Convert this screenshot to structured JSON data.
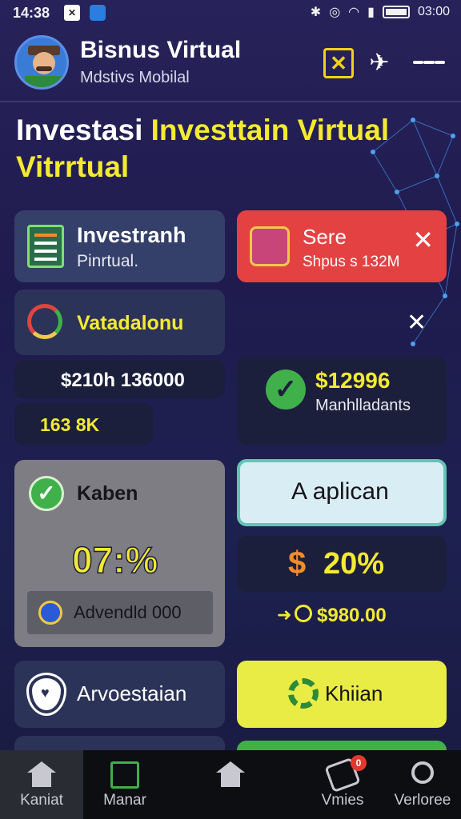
{
  "status_bar": {
    "time": "14:38",
    "clock_right": "03:00"
  },
  "header": {
    "title": "Bisnus Virtual",
    "subtitle": "Mdstivs Mobilal"
  },
  "headline": {
    "part1": "Investasi ",
    "part2": "Investtain Virtual",
    "part3": "Vitrrtual"
  },
  "cards": {
    "investrani": {
      "title": "Investranh",
      "subtitle": "Pinrtual."
    },
    "sere": {
      "title": "Sere",
      "subtitle": "Shpus s 132M"
    },
    "vatadalonu": {
      "title": "Vatadalonu"
    },
    "amount1": {
      "value": "$210h 136000"
    },
    "amount2": {
      "value": "163 8K"
    },
    "percent_card": {
      "value": "$12996",
      "label": "Manhlladants"
    },
    "kaben": {
      "title": "Kaben",
      "value": "07:%",
      "advert": "Advendld 000"
    },
    "apply": {
      "label": "A aplican"
    },
    "growth": {
      "value": "20%"
    },
    "total": {
      "value": "$980.00"
    },
    "arvestaian": {
      "label": "Arvoestaian"
    },
    "khiian": {
      "label": "Khiian"
    }
  },
  "bottom_nav": [
    {
      "label": "Kaniat"
    },
    {
      "label": "Manar"
    },
    {
      "label": ""
    },
    {
      "label": "Vmies",
      "badge": "0"
    },
    {
      "label": "Verloree"
    }
  ],
  "colors": {
    "accent_yellow": "#f4ea30",
    "alert_red": "#e44242",
    "success_green": "#3fb04a",
    "apply_bg": "#d9edf4",
    "apply_border": "#64c4b4"
  }
}
